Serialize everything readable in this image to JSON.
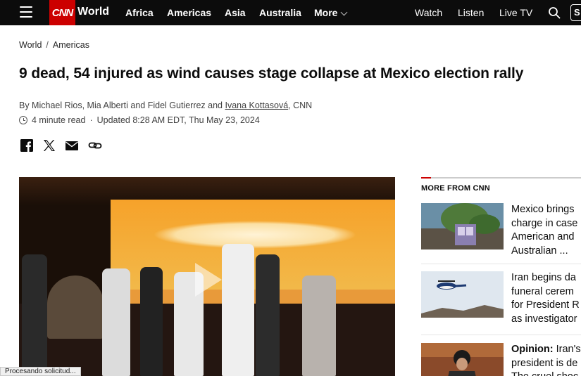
{
  "nav": {
    "section": "World",
    "logo_text": "CNN",
    "links": [
      "Africa",
      "Americas",
      "Asia",
      "Australia",
      "More"
    ],
    "right_links": [
      "Watch",
      "Listen",
      "Live TV"
    ],
    "signin_stub": "S"
  },
  "breadcrumb": [
    "World",
    "Americas"
  ],
  "article": {
    "headline": "9 dead, 54 injured as wind causes stage collapse at Mexico election rally",
    "byline_prefix": "By Michael Rios, Mia Alberti and Fidel Gutierrez and ",
    "byline_author_link": "Ivana Kottasová",
    "byline_suffix": ", CNN",
    "read_time": "4 minute read",
    "updated": "Updated 8:28 AM EDT, Thu May 23, 2024"
  },
  "share_icons": [
    "facebook-icon",
    "x-icon",
    "email-icon",
    "link-icon"
  ],
  "more": {
    "title": "MORE FROM CNN",
    "cards": [
      {
        "lines": [
          "Mexico brings",
          "charge in case",
          "American and",
          "Australian ..."
        ],
        "opinion": ""
      },
      {
        "lines": [
          "Iran begins da",
          "funeral cerem",
          "for President R",
          "as investigator"
        ],
        "opinion": ""
      },
      {
        "lines": [
          "Iran's",
          "president is de",
          "The cruel shoc"
        ],
        "opinion": "Opinion:"
      }
    ]
  },
  "status_text": "Procesando solicitud...",
  "colors": {
    "brand_red": "#cc0000",
    "nav_bg": "#0c0c0c"
  }
}
